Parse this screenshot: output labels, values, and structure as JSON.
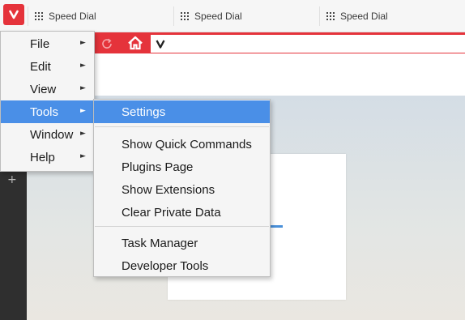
{
  "browser": {
    "brand_color": "#e5333b",
    "selection_color": "#4a8fe7",
    "logo_icon": "vivaldi-logo-icon",
    "address_bar_text": "v"
  },
  "tabs": [
    {
      "label": "Speed Dial",
      "icon": "speed-dial-grid-icon"
    },
    {
      "label": "Speed Dial",
      "icon": "speed-dial-grid-icon"
    },
    {
      "label": "Speed Dial",
      "icon": "speed-dial-grid-icon"
    }
  ],
  "toolbar": {
    "reload_icon": "reload-icon",
    "home_icon": "home-icon"
  },
  "sidepanel": {
    "add_symbol": "+"
  },
  "main_menu": {
    "items": [
      {
        "label": "File",
        "submenu_arrow": "►"
      },
      {
        "label": "Edit",
        "submenu_arrow": "►"
      },
      {
        "label": "View",
        "submenu_arrow": "►"
      },
      {
        "label": "Tools",
        "submenu_arrow": "►",
        "active": true
      },
      {
        "label": "Window",
        "submenu_arrow": "►"
      },
      {
        "label": "Help",
        "submenu_arrow": "►"
      }
    ]
  },
  "tools_menu": {
    "items": [
      {
        "label": "Settings",
        "active": true
      },
      {
        "label": "Show Quick Commands"
      },
      {
        "label": "Plugins Page"
      },
      {
        "label": "Show Extensions"
      },
      {
        "label": "Clear Private Data"
      },
      {
        "label": "Task Manager"
      },
      {
        "label": "Developer Tools"
      }
    ]
  }
}
